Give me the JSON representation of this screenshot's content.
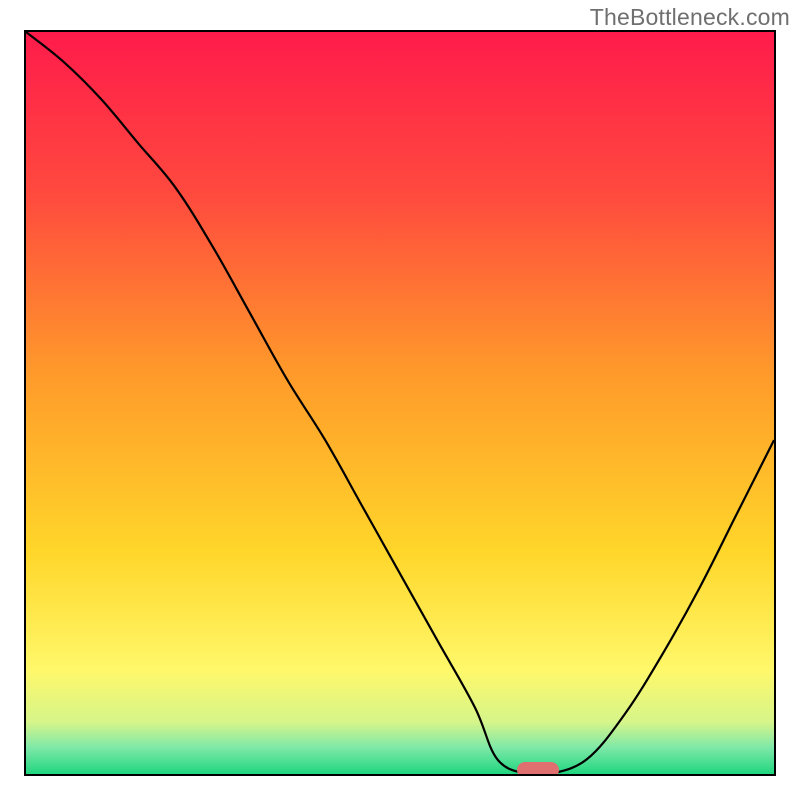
{
  "watermark": "TheBottleneck.com",
  "chart_data": {
    "type": "line",
    "title": "",
    "xlabel": "",
    "ylabel": "",
    "xlim": [
      0,
      100
    ],
    "ylim": [
      0,
      100
    ],
    "x": [
      0,
      5,
      10,
      15,
      20,
      25,
      30,
      35,
      40,
      45,
      50,
      55,
      60,
      63,
      67,
      70,
      75,
      80,
      85,
      90,
      95,
      100
    ],
    "values": [
      100,
      96,
      91,
      85,
      79,
      71,
      62,
      53,
      45,
      36,
      27,
      18,
      9,
      2,
      0,
      0,
      2,
      8,
      16,
      25,
      35,
      45
    ],
    "gradient_stops": [
      {
        "pos": 0.0,
        "color": "#ff1b4b"
      },
      {
        "pos": 0.22,
        "color": "#ff4a3e"
      },
      {
        "pos": 0.46,
        "color": "#ff9a2a"
      },
      {
        "pos": 0.7,
        "color": "#ffd62a"
      },
      {
        "pos": 0.86,
        "color": "#fff86a"
      },
      {
        "pos": 0.93,
        "color": "#d6f58a"
      },
      {
        "pos": 0.965,
        "color": "#7de8a8"
      },
      {
        "pos": 1.0,
        "color": "#1fd67f"
      }
    ],
    "marker": {
      "x": 68.5,
      "y": 0.5,
      "color": "#e07070"
    }
  }
}
